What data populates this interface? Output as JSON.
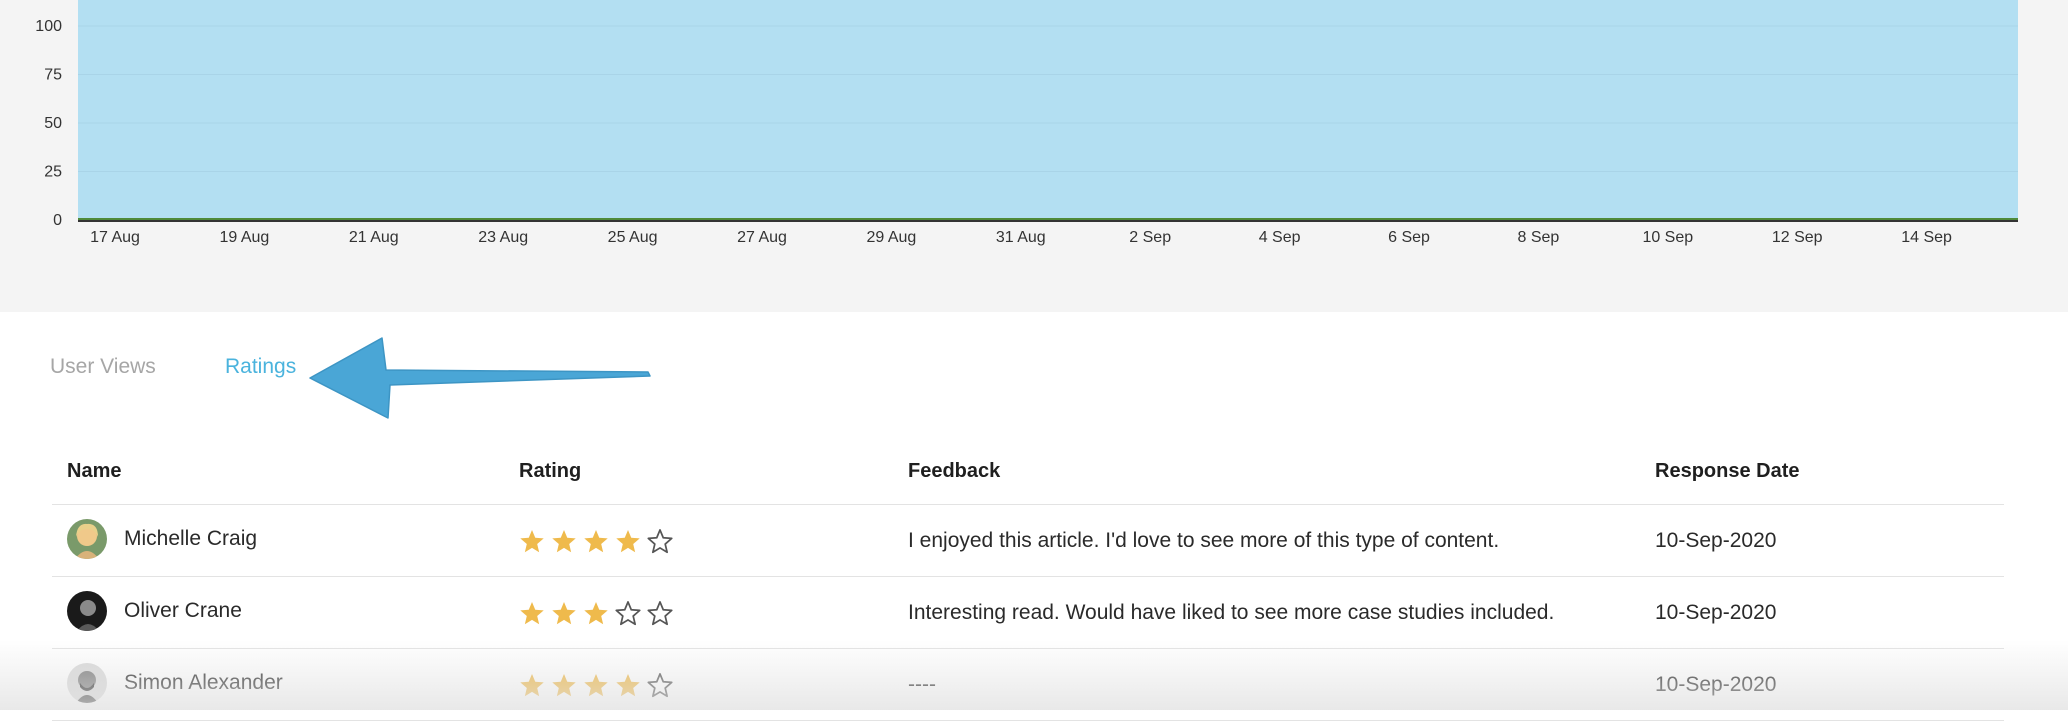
{
  "chart_data": {
    "type": "area",
    "x": [
      "17 Aug",
      "19 Aug",
      "21 Aug",
      "23 Aug",
      "25 Aug",
      "27 Aug",
      "29 Aug",
      "31 Aug",
      "2 Sep",
      "4 Sep",
      "6 Sep",
      "8 Sep",
      "10 Sep",
      "12 Sep",
      "14 Sep"
    ],
    "yticks": [
      0,
      25,
      50,
      75,
      100
    ],
    "series": [
      {
        "values": [
          200,
          200,
          200,
          200,
          200,
          200,
          200,
          200,
          200,
          200,
          200,
          200,
          200,
          200,
          200
        ],
        "color": "#b3dff2"
      },
      {
        "values": [
          0,
          0,
          0,
          0,
          0,
          0,
          0,
          0,
          0,
          0,
          0,
          0,
          0,
          0,
          0
        ],
        "color": "#4f8a3a"
      }
    ],
    "grid": true
  },
  "tabs": [
    {
      "label": "User Views",
      "active": false
    },
    {
      "label": "Ratings",
      "active": true
    }
  ],
  "table": {
    "headers": {
      "name": "Name",
      "rating": "Rating",
      "feedback": "Feedback",
      "date": "Response Date"
    },
    "rows": [
      {
        "name": "Michelle Craig",
        "rating": 4,
        "feedback": "I enjoyed this article. I'd love to see more of this type of content.",
        "date": "10-Sep-2020"
      },
      {
        "name": "Oliver Crane",
        "rating": 3,
        "feedback": "Interesting read. Would have liked to see more case studies included.",
        "date": "10-Sep-2020"
      },
      {
        "name": "Simon Alexander",
        "rating": 4,
        "feedback": "----",
        "date": "10-Sep-2020"
      }
    ],
    "max_rating": 5
  },
  "colors": {
    "accent": "#4ab3dd",
    "arrow": "#4aa6d6",
    "star_filled": "#efba4c",
    "star_empty": "#555555"
  }
}
